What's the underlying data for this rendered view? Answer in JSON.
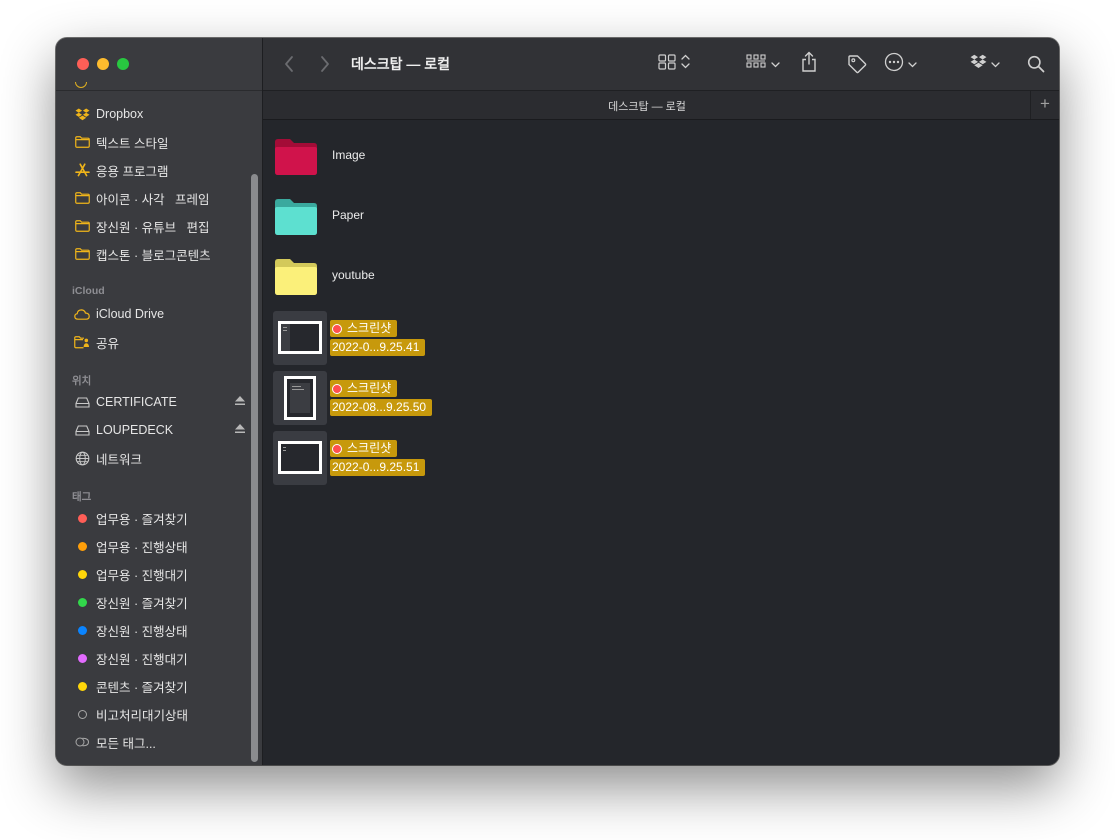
{
  "window": {
    "title": "데스크탑 — 로컬",
    "path_label": "데스크탑 — 로컬"
  },
  "sidebar": {
    "items_top": [
      {
        "label": "Dropbox",
        "icon": "dropbox-icon"
      },
      {
        "label": "텍스트 스타일",
        "icon": "folder-icon"
      },
      {
        "label": "응용 프로그램",
        "icon": "applications-icon"
      },
      {
        "label": "아이콘 · 사각   프레임",
        "icon": "folder-icon"
      },
      {
        "label": "장신원 · 유튜브   편집",
        "icon": "folder-icon"
      },
      {
        "label": "캡스톤 · 블로그콘텐츠",
        "icon": "folder-icon"
      }
    ],
    "icloud_header": "iCloud",
    "icloud_items": [
      {
        "label": "iCloud Drive",
        "icon": "cloud-icon"
      },
      {
        "label": "공유",
        "icon": "shared-folder-icon"
      }
    ],
    "locations_header": "위치",
    "locations": [
      {
        "label": "CERTIFICATE",
        "icon": "drive-icon",
        "eject": true
      },
      {
        "label": "LOUPEDECK",
        "icon": "drive-icon",
        "eject": true
      },
      {
        "label": "네트워크",
        "icon": "globe-icon",
        "eject": false
      }
    ],
    "tags_header": "태그",
    "tags": [
      {
        "label": "업무용 · 즐겨찾기",
        "color": "#ff5e57"
      },
      {
        "label": "업무용 · 진행상태",
        "color": "#ff9f0a"
      },
      {
        "label": "업무용 · 진행대기",
        "color": "#ffd60a"
      },
      {
        "label": "장신원 · 즐겨찾기",
        "color": "#32d74b"
      },
      {
        "label": "장신원 · 진행상태",
        "color": "#0a84ff"
      },
      {
        "label": "장신원 · 진행대기",
        "color": "#e36bff"
      },
      {
        "label": "콘텐츠 · 즐겨찾기",
        "color": "#ffd60a"
      },
      {
        "label": "비고처리대기상태",
        "color": ""
      },
      {
        "label": "모든 태그...",
        "color": ""
      }
    ]
  },
  "files": {
    "folders": [
      {
        "name": "Image",
        "color": "#d0134b"
      },
      {
        "name": "Paper",
        "color": "#5de0d0"
      },
      {
        "name": "youtube",
        "color": "#fbf07a"
      }
    ],
    "screenshots": [
      {
        "line1": "스크린샷",
        "line2": "2022-0...9.25.41",
        "orientation": "landscape"
      },
      {
        "line1": "스크린샷",
        "line2": "2022-08...9.25.50",
        "orientation": "portrait"
      },
      {
        "line1": "스크린샷",
        "line2": "2022-0...9.25.51",
        "orientation": "landscape"
      }
    ],
    "tag_color": "#ff4f4f",
    "highlight_color": "#c7990c"
  },
  "toolbar": {
    "icons": [
      "back-icon",
      "forward-icon",
      "grid-view-icon",
      "group-icon",
      "share-icon",
      "tag-icon",
      "more-icon",
      "dropbox-icon",
      "search-icon"
    ]
  }
}
